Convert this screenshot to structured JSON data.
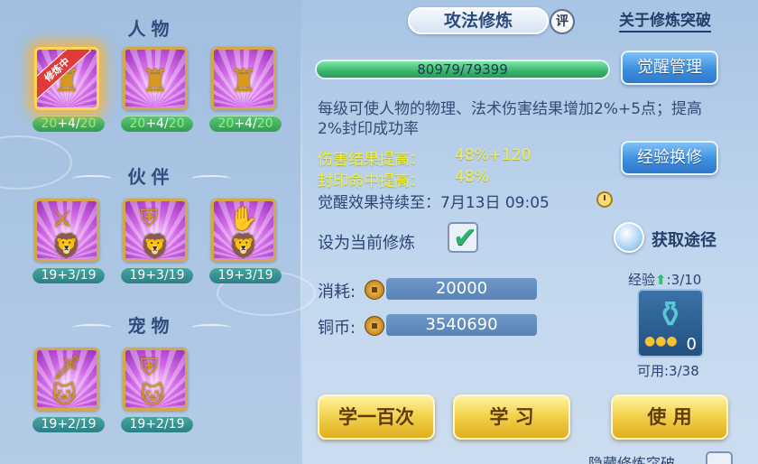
{
  "left": {
    "sections": [
      {
        "title": "人物",
        "slots": [
          {
            "icon": "warrior-figure",
            "badge": "修炼中",
            "base": "20",
            "plus": "+4/",
            "max": "20",
            "active": true
          },
          {
            "icon": "warrior-figure",
            "badge": "",
            "base": "20",
            "plus": "+4/",
            "max": "20",
            "active": false
          },
          {
            "icon": "warrior-figure",
            "badge": "",
            "base": "20",
            "plus": "+4/",
            "max": "20",
            "active": false
          }
        ]
      },
      {
        "title": "伙伴",
        "slots": [
          {
            "icon": "sword-lion",
            "level": "19+3/19"
          },
          {
            "icon": "shield-lion",
            "level": "19+3/19"
          },
          {
            "icon": "hand-lion",
            "level": "19+3/19"
          }
        ]
      },
      {
        "title": "宠物",
        "slots": [
          {
            "icon": "sword-cat",
            "level": "19+2/19"
          },
          {
            "icon": "shield-cat",
            "level": "19+2/19"
          }
        ]
      }
    ]
  },
  "header": {
    "title": "攻法修炼",
    "rate_label": "评",
    "about_link": "关于修炼突破"
  },
  "progress": {
    "text": "80979/79399",
    "fill_fraction": 1.0
  },
  "buttons": {
    "awaken_manage": "觉醒管理",
    "exp_exchange": "经验换修",
    "learn_hundred": "学一百次",
    "learn": "学 习",
    "use": "使 用"
  },
  "description": "每级可使人物的物理、法术伤害结果增加2%+5点；提高2%封印成功率",
  "stats": [
    {
      "label": "伤害结果提高：",
      "value": "48%+120"
    },
    {
      "label": "封印命中提高：",
      "value": "48%"
    }
  ],
  "awaken_expire": "觉醒效果持续至：7月13日 09:05",
  "set_current_label": "设为当前修炼",
  "set_current_checked": true,
  "obtain_label": "获取途径",
  "costs": {
    "consume_label": "消耗:",
    "consume_value": "20000",
    "coin_label": "铜币:",
    "coin_value": "3540690"
  },
  "item": {
    "exp_label": "经验",
    "exp_value": ":3/10",
    "count": "0",
    "available": "可用:3/38",
    "icon": "vase-icon"
  },
  "bottom_cut_text": "隐藏修炼突破",
  "colors": {
    "accent_gold": "#f3d34f",
    "accent_blue": "#3d8fe0",
    "progress_green": "#3bb56c",
    "stat_yellow": "#f1f23a"
  }
}
